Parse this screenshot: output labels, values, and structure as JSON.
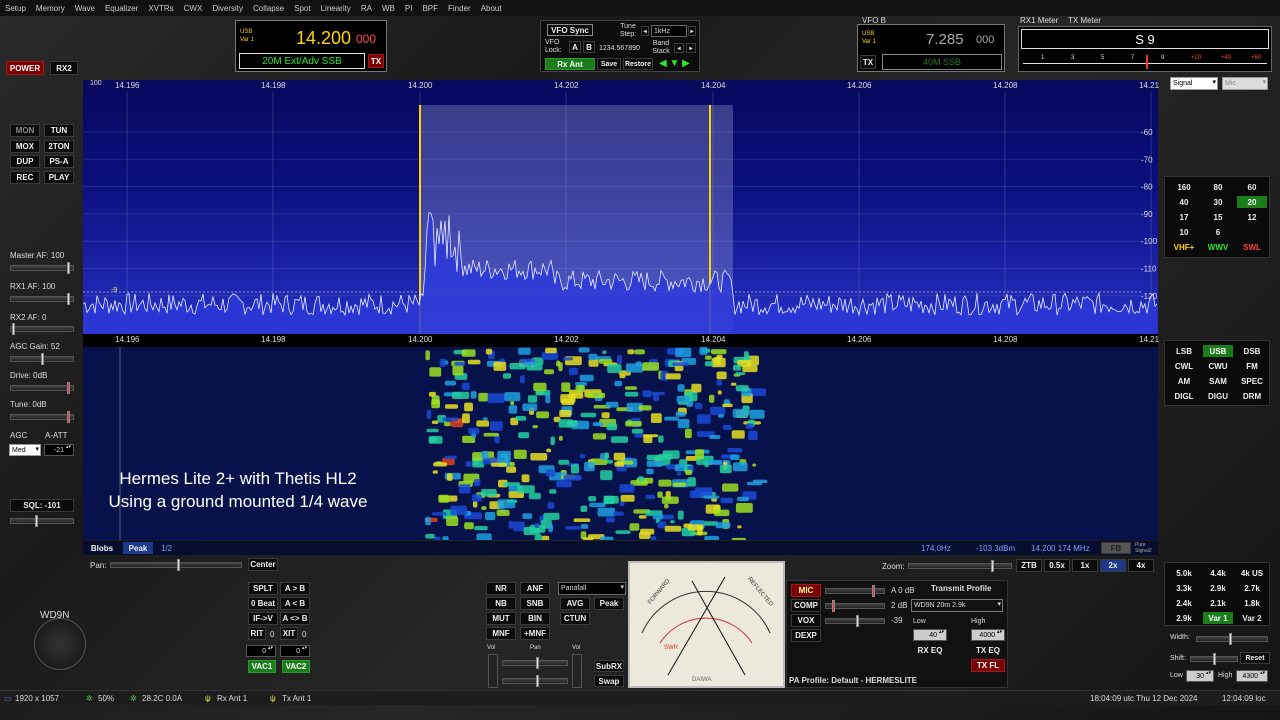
{
  "menu": [
    "Setup",
    "Memory",
    "Wave",
    "Equalizer",
    "XVTRs",
    "CWX",
    "Diversity",
    "Collapse",
    "Spot",
    "Linearity",
    "RA",
    "WB",
    "PI",
    "BPF",
    "Finder",
    "About"
  ],
  "left": {
    "power": "POWER",
    "rx2": "RX2",
    "mon": "MON",
    "tun": "TUN",
    "mox": "MOX",
    "ton2": "2TON",
    "dup": "DUP",
    "psa": "PS-A",
    "rec": "REC",
    "play": "PLAY",
    "master_af": "Master AF:  100",
    "rx1_af": "RX1 AF:  100",
    "rx2_af": "RX2 AF:  0",
    "agc_gain": "AGC Gain:  52",
    "drive": "Drive:  0dB",
    "tune": "Tune:  0dB",
    "agc": "AGC",
    "a_att": "A-ATT",
    "agc_mode": "Med",
    "att_value": "-21",
    "sql": "SQL:  -101"
  },
  "vfoa": {
    "mode": "USB",
    "var": "Var 1",
    "freq": "14.200",
    "freq_sub": "000",
    "band": "20M Ext/Adv SSB",
    "tx": "TX"
  },
  "vfo_ctrl": {
    "sync": "VFO Sync",
    "lock": "VFO Lock:",
    "a": "A",
    "b": "B",
    "digits": "1234.567890",
    "tune_step": "Tune Step:",
    "step": "1kHz",
    "band_stack": "Band Stack",
    "rx_ant": "Rx Ant",
    "save": "Save",
    "restore": "Restore"
  },
  "vfob": {
    "label": "VFO B",
    "mode": "USB",
    "var": "Var 1",
    "freq": "7.285",
    "freq_sub": "000",
    "band": "40M SSB",
    "tx": "TX"
  },
  "meter": {
    "rx1": "RX1 Meter",
    "tx": "TX Meter",
    "reading": "S 9",
    "scale": [
      "1",
      "3",
      "5",
      "7",
      "9",
      "+20",
      "+40",
      "+60"
    ],
    "rx_sel": "Signal",
    "tx_sel": "Mic"
  },
  "spectrum": {
    "top_db": "100",
    "freq_labels": [
      "14.196",
      "14.198",
      "14.200",
      "14.202",
      "14.204",
      "14.206",
      "14.208",
      "14.21"
    ],
    "db_labels": [
      "-60",
      "-70",
      "-80",
      "-90",
      "-100",
      "-110",
      "-120"
    ],
    "marker": "-9"
  },
  "overlay": {
    "line1": "Hermes Lite 2+ with Thetis HL2",
    "line2": "Using a ground mounted 1/4 wave"
  },
  "status": {
    "blobs": "Blobs",
    "peak": "Peak",
    "half": "1/2",
    "offset": "174.0Hz",
    "dbm": "-103.3dBm",
    "cursor": "14.200 174 MHz",
    "fb": "FB",
    "pure": "Pure Signal2"
  },
  "bands": [
    "160",
    "80",
    "60",
    "40",
    "30",
    "20",
    "17",
    "15",
    "12",
    "10",
    "6"
  ],
  "band_extra": [
    "VHF+",
    "WWV",
    "SWL"
  ],
  "modes": [
    "LSB",
    "USB",
    "DSB",
    "CWL",
    "CWU",
    "FM",
    "AM",
    "SAM",
    "SPEC",
    "DIGL",
    "DIGU",
    "DRM"
  ],
  "bottom": {
    "pan": "Pan:",
    "center": "Center",
    "splt": "SPLT",
    "ab": "A > B",
    "beat": "0 Beat",
    "ba": "A < B",
    "ifv": "IF->V",
    "swap": "A <> B",
    "rit": "RIT",
    "rit_v": "0",
    "xit": "XIT",
    "xit_v": "0",
    "rit_num": "0",
    "xit_num": "0",
    "vac1": "VAC1",
    "vac2": "VAC2",
    "nr": "NR",
    "anf": "ANF",
    "nb": "NB",
    "snb": "SNB",
    "mut": "MUT",
    "bin": "BIN",
    "mnf": "MNF",
    "pmnf": "+MNF",
    "display": "Panafall",
    "avg": "AVG",
    "peak": "Peak",
    "ctun": "CTUN",
    "vol": "Vol",
    "pan2": "Pan",
    "vol2": "Vol",
    "subrx": "SubRX",
    "swap2": "Swap",
    "meter_fwd": "FORWARD",
    "meter_ref": "REFLECTED",
    "meter_swr": "SWR",
    "meter_brand": "DAIWA",
    "mic": "MIC",
    "comp": "COMP",
    "vox": "VOX",
    "dexp": "DEXP",
    "mic_v": "A 0 dB",
    "comp_v": "2 dB",
    "vox_v": "-39",
    "tx_profile_lbl": "Transmit Profile",
    "tx_profile": "WD9N 20m 2.9k",
    "low": "Low",
    "high": "High",
    "low_v": "40",
    "high_v": "4000",
    "rx_eq": "RX EQ",
    "tx_eq": "TX EQ",
    "tx_fl": "TX FL",
    "pa_profile": "PA Profile: Default - HERMESLITE",
    "zoom": "Zoom:",
    "ztb": "ZTB",
    "z05": "0.5x",
    "z1": "1x",
    "z2": "2x",
    "z4": "4x",
    "filters": [
      "5.0k",
      "4.4k",
      "4k US",
      "3.3k",
      "2.9k",
      "2.7k",
      "2.4k",
      "2.1k",
      "1.8k",
      "2.9k",
      "Var 1",
      "Var 2"
    ],
    "width": "Width:",
    "shift": "Shift:",
    "reset": "Reset",
    "low2": "Low",
    "low2_v": "30",
    "high2": "High",
    "high2_v": "4300",
    "logo": "WD9N"
  },
  "footer": {
    "res": "1920 x 1057",
    "cpu": "50%",
    "temp": "28.2C  0.0A",
    "rx_ant": "Rx Ant 1",
    "tx_ant": "Tx Ant 1",
    "utc": "18:04:09 utc  Thu 12 Dec 2024",
    "loc": "12:04:09 loc"
  },
  "colors": {
    "accent_green": "#1a7d1a",
    "accent_red": "#7b0000",
    "vfo_text": "#ffd400",
    "band_text": "#2ee62e"
  }
}
